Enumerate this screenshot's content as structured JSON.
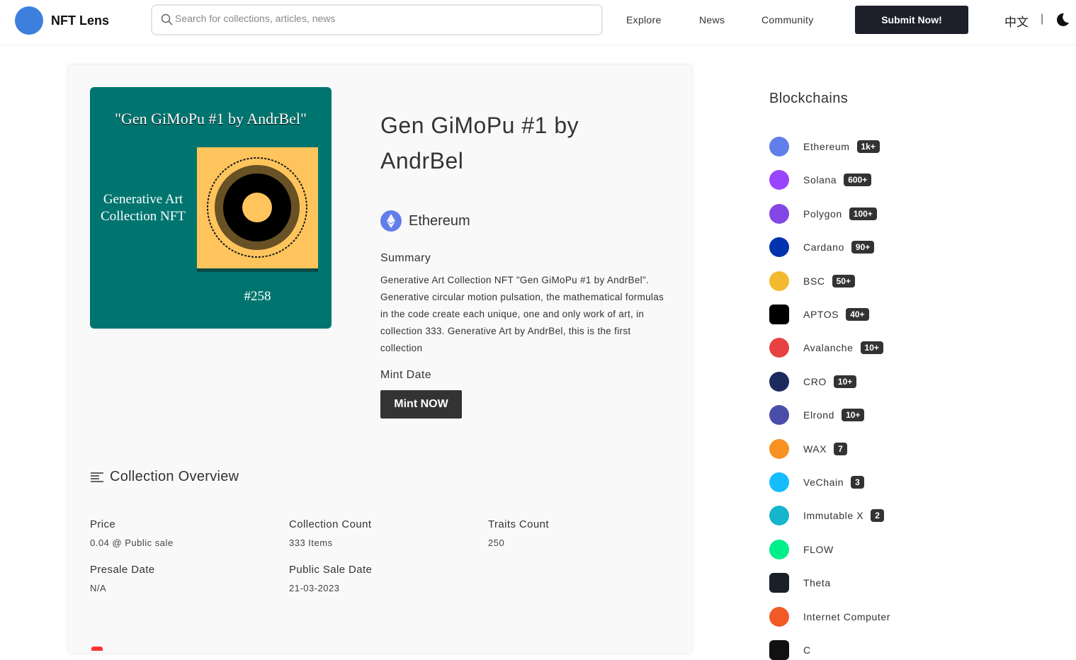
{
  "header": {
    "brand": "NFT Lens",
    "search_placeholder": "Search for collections, articles, news",
    "nav": [
      "Explore",
      "News",
      "Community"
    ],
    "submit": "Submit Now!",
    "lang": "中文",
    "sep": "|"
  },
  "artwork": {
    "caption": "\"Gen GiMoPu #1 by AndrBel\"",
    "line1": "Generative Art",
    "line2": "Collection NFT",
    "number": "#258"
  },
  "nft": {
    "title": "Gen GiMoPu #1 by AndrBel",
    "chain": "Ethereum",
    "summary_label": "Summary",
    "summary": "Generative Art Collection NFT \"Gen GiMoPu #1 by AndrBel\". Generative circular motion pulsation, the mathematical formulas in the code create each unique, one and only work of art, in collection 333. Generative Art by AndrBel, this is the first collection",
    "mint_label": "Mint Date",
    "mint_button": "Mint NOW"
  },
  "overview": {
    "title": "Collection Overview",
    "fields": [
      {
        "label": "Price",
        "value": "0.04 @ Public sale"
      },
      {
        "label": "Collection Count",
        "value": "333 Items"
      },
      {
        "label": "Traits Count",
        "value": "250"
      },
      {
        "label": "Presale Date",
        "value": "N/A"
      },
      {
        "label": "Public Sale Date",
        "value": "21-03-2023"
      }
    ]
  },
  "sidebar": {
    "title": "Blockchains",
    "items": [
      {
        "name": "Ethereum",
        "count": "1k+",
        "color": "#627eea"
      },
      {
        "name": "Solana",
        "count": "600+",
        "color": "#9945ff"
      },
      {
        "name": "Polygon",
        "count": "100+",
        "color": "#8247e5"
      },
      {
        "name": "Cardano",
        "count": "90+",
        "color": "#0033ad"
      },
      {
        "name": "BSC",
        "count": "50+",
        "color": "#f3ba2f"
      },
      {
        "name": "APTOS",
        "count": "40+",
        "color": "#000000"
      },
      {
        "name": "Avalanche",
        "count": "10+",
        "color": "#e84142"
      },
      {
        "name": "CRO",
        "count": "10+",
        "color": "#1c2a5e"
      },
      {
        "name": "Elrond",
        "count": "10+",
        "color": "#4a4eaa"
      },
      {
        "name": "WAX",
        "count": "7",
        "color": "#f89022"
      },
      {
        "name": "VeChain",
        "count": "3",
        "color": "#15bdff"
      },
      {
        "name": "Immutable X",
        "count": "2",
        "color": "#17b5cb"
      },
      {
        "name": "FLOW",
        "count": "",
        "color": "#00ef8b"
      },
      {
        "name": "Theta",
        "count": "",
        "color": "#1b1f2a"
      },
      {
        "name": "Internet Computer",
        "count": "",
        "color": "#f15a24"
      },
      {
        "name": "C",
        "count": "",
        "color": "#111111"
      }
    ]
  }
}
